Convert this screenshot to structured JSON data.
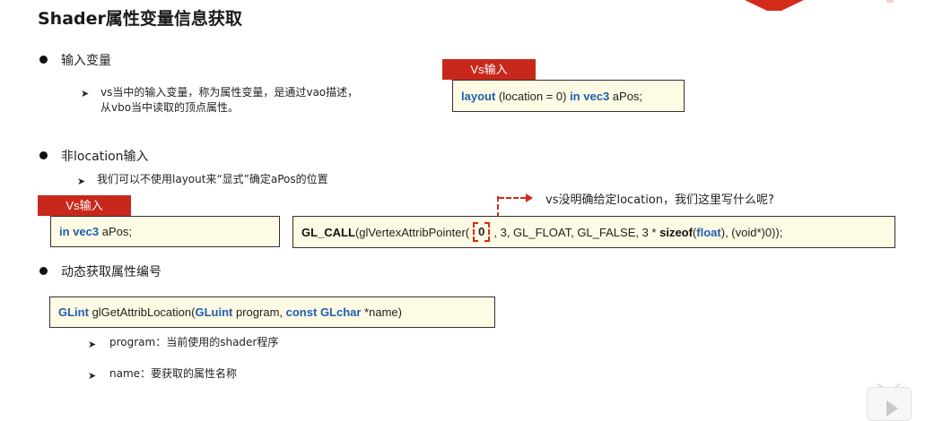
{
  "title": "Shader属性变量信息获取",
  "sections": {
    "input_vars": {
      "heading": "输入变量",
      "desc_line1": "vs当中的输入变量，称为属性变量，是通过vao描述，",
      "desc_line2": "从vbo当中读取的顶点属性。",
      "tag": "Vs输入",
      "code": {
        "kw1": "layout",
        "mid": "(location = 0)",
        "kw2": "in",
        "kw3": "vec3",
        "name": "aPos;"
      }
    },
    "non_location": {
      "heading": "非location输入",
      "desc": "我们可以不使用layout来“显式”确定aPos的位置",
      "tag": "Vs输入",
      "code": {
        "kw1": "in",
        "kw2": "vec3",
        "name": "aPos;"
      },
      "callout": "vs没明确给定location，我们这里写什么呢?",
      "gl_call": {
        "macro": "GL_CALL",
        "func_open": "(glVertexAttribPointer(",
        "index": "0",
        "args": ", 3, GL_FLOAT, GL_FALSE, 3 *",
        "sizeof": "sizeof",
        "paren_open": "(",
        "float_kw": "float",
        "tail": "), (void*)0));"
      }
    },
    "dynamic": {
      "heading": "动态获取属性编号",
      "signature": {
        "ret_type": "GLint",
        "func": "glGetAttribLocation(",
        "p1_type": "GLuint",
        "p1_name": "program,",
        "p2_const": "const",
        "p2_type": "GLchar",
        "p2_name": "*name)"
      },
      "params": [
        "program：当前使用的shader程序",
        "name：要获取的属性名称"
      ]
    }
  },
  "colors": {
    "accent_red": "#c8281c",
    "keyword_blue": "#1f5fb0",
    "code_bg": "#fdfbe4"
  },
  "icons": {
    "bullet": "filled-circle",
    "sub_bullet": "arrowhead-right",
    "play": "play-triangle"
  }
}
